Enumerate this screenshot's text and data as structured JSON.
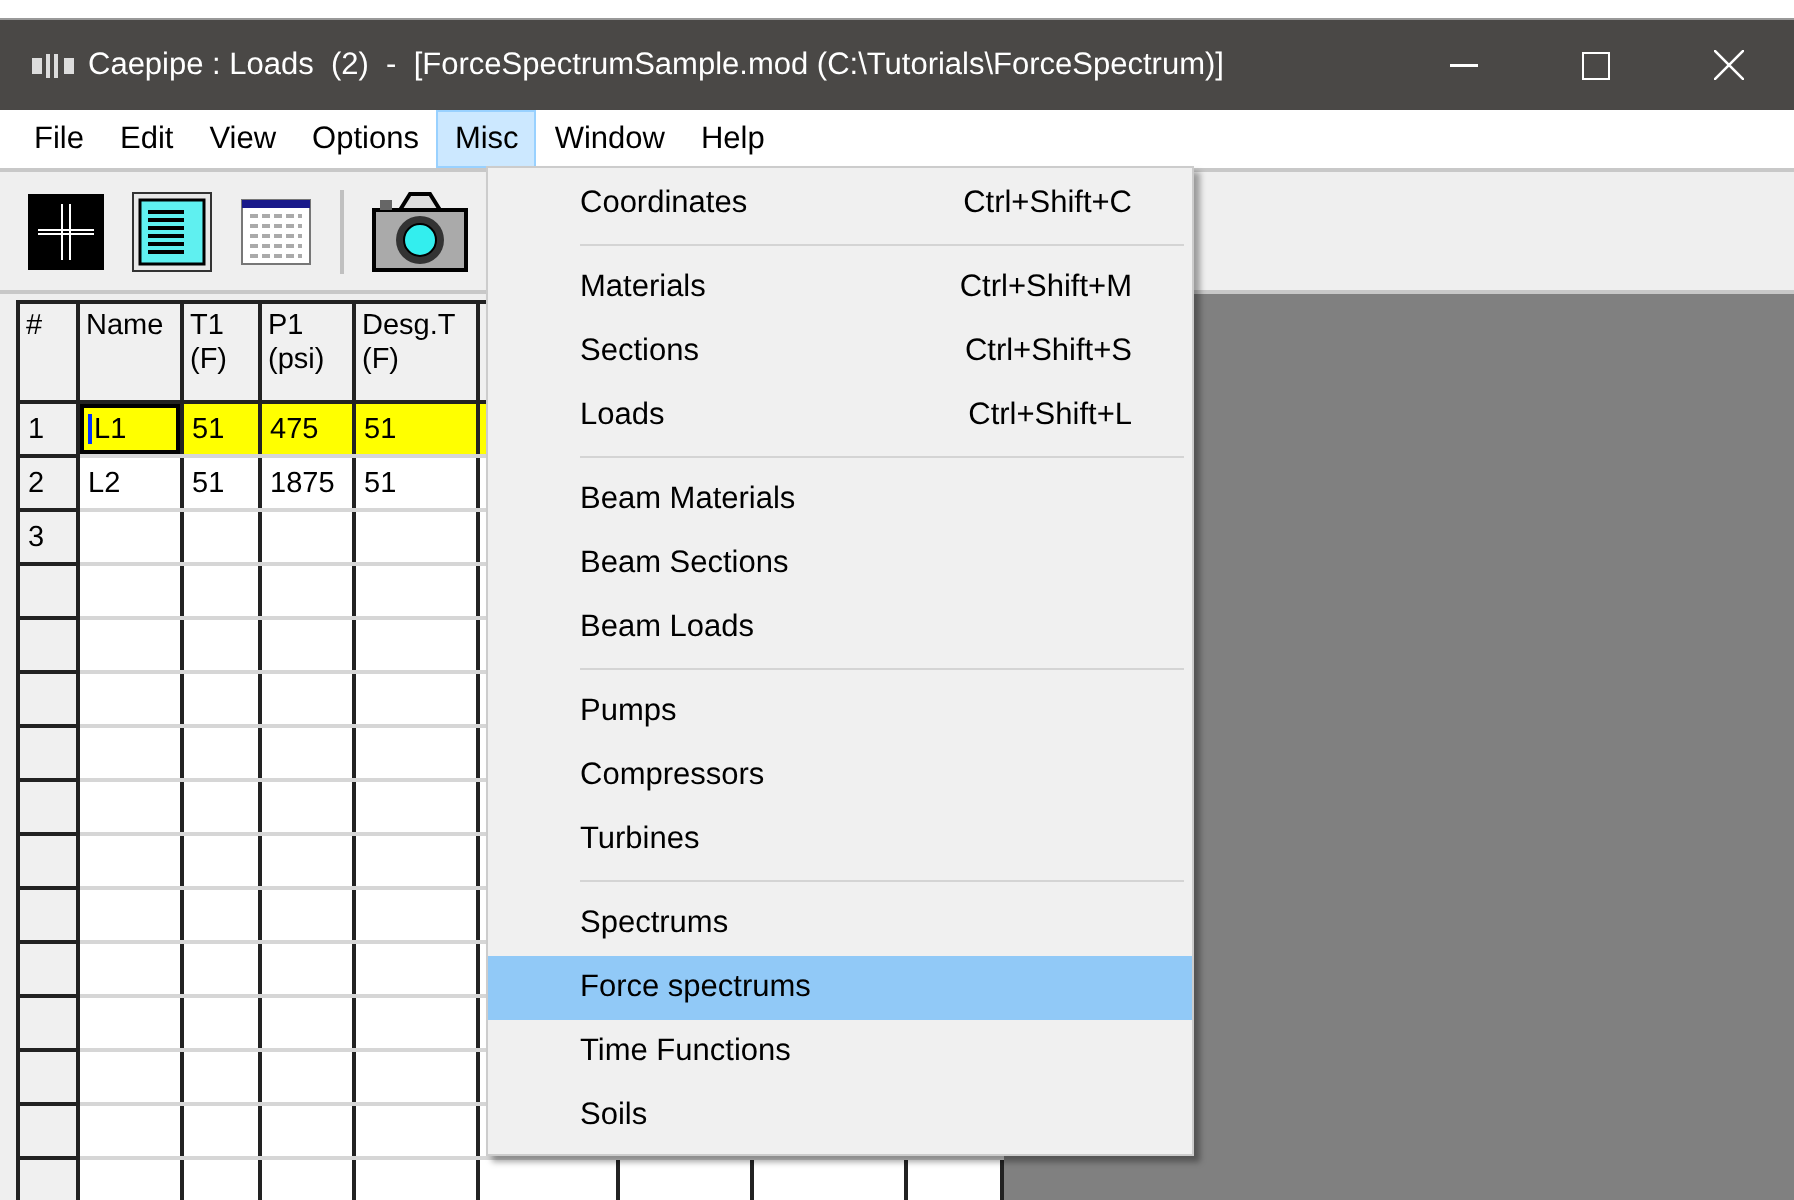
{
  "window": {
    "title": "Caepipe : Loads  (2)  -  [ForceSpectrumSample.mod (C:\\Tutorials\\ForceSpectrum)]"
  },
  "menu_bar": [
    {
      "label": "File",
      "selected": false
    },
    {
      "label": "Edit",
      "selected": false
    },
    {
      "label": "View",
      "selected": false
    },
    {
      "label": "Options",
      "selected": false
    },
    {
      "label": "Misc",
      "selected": true
    },
    {
      "label": "Window",
      "selected": false
    },
    {
      "label": "Help",
      "selected": false
    }
  ],
  "table": {
    "columns": [
      {
        "label": "#"
      },
      {
        "label": "Name"
      },
      {
        "label": "T1",
        "unit": "(F)"
      },
      {
        "label": "P1",
        "unit": "(psi)"
      },
      {
        "label": "Desg.T",
        "unit": "(F)"
      }
    ],
    "rows": [
      {
        "number": "1",
        "cells": [
          "L1",
          "51",
          "475",
          "51"
        ],
        "selected": true,
        "editing": true
      },
      {
        "number": "2",
        "cells": [
          "L2",
          "51",
          "1875",
          "51"
        ],
        "selected": false,
        "editing": false
      },
      {
        "number": "3",
        "selected": false,
        "editing": false
      }
    ]
  },
  "dropdown": {
    "items": [
      {
        "kind": "item",
        "label": "Coordinates",
        "shortcut": "Ctrl+Shift+C",
        "selected": false
      },
      {
        "kind": "separator"
      },
      {
        "kind": "item",
        "label": "Materials",
        "shortcut": "Ctrl+Shift+M",
        "selected": false
      },
      {
        "kind": "item",
        "label": "Sections",
        "shortcut": "Ctrl+Shift+S",
        "selected": false
      },
      {
        "kind": "item",
        "label": "Loads",
        "shortcut": "Ctrl+Shift+L",
        "selected": false
      },
      {
        "kind": "separator"
      },
      {
        "kind": "item",
        "label": "Beam Materials",
        "selected": false
      },
      {
        "kind": "item",
        "label": "Beam Sections",
        "selected": false
      },
      {
        "kind": "item",
        "label": "Beam Loads",
        "selected": false
      },
      {
        "kind": "separator"
      },
      {
        "kind": "item",
        "label": "Pumps",
        "selected": false
      },
      {
        "kind": "item",
        "label": "Compressors",
        "selected": false
      },
      {
        "kind": "item",
        "label": "Turbines",
        "selected": false
      },
      {
        "kind": "separator"
      },
      {
        "kind": "item",
        "label": "Spectrums",
        "selected": false
      },
      {
        "kind": "item",
        "label": "Force spectrums",
        "selected": true
      },
      {
        "kind": "item",
        "label": "Time Functions",
        "selected": false
      },
      {
        "kind": "item",
        "label": "Soils",
        "selected": false
      }
    ]
  }
}
